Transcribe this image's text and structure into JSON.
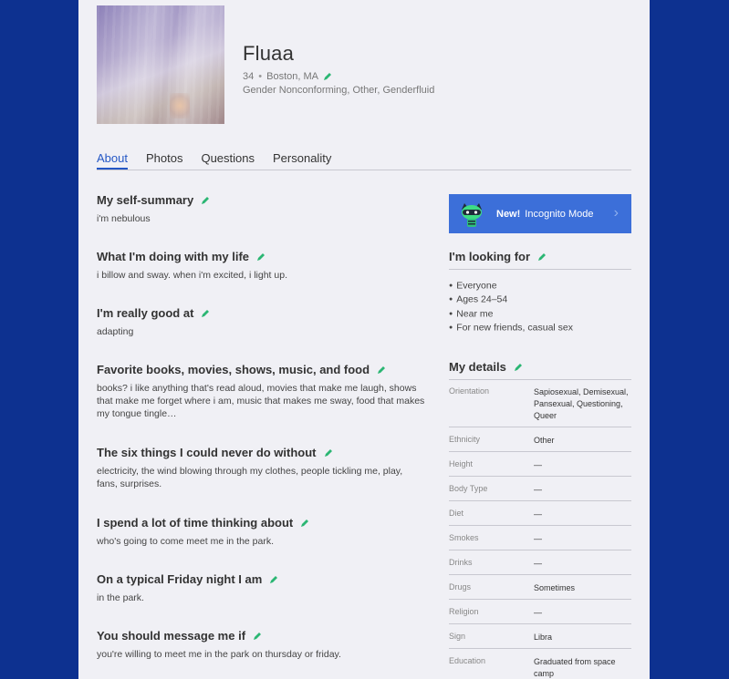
{
  "profile": {
    "name": "Fluaa",
    "age": "34",
    "location": "Boston, MA",
    "gender": "Gender Nonconforming, Other, Genderfluid"
  },
  "tabs": [
    "About",
    "Photos",
    "Questions",
    "Personality"
  ],
  "essays": [
    {
      "title": "My self-summary",
      "text": "i'm nebulous"
    },
    {
      "title": "What I'm doing with my life",
      "text": "i billow and sway. when i'm excited, i light up."
    },
    {
      "title": "I'm really good at",
      "text": "adapting"
    },
    {
      "title": "Favorite books, movies, shows, music, and food",
      "text": "books? i like anything that's read aloud, movies that make me laugh, shows that make me forget where i am, music that makes me sway, food that makes my tongue tingle…"
    },
    {
      "title": "The six things I could never do without",
      "text": "electricity, the wind blowing through my clothes, people tickling me, play, fans, surprises."
    },
    {
      "title": "I spend a lot of time thinking about",
      "text": "who's going to come meet me in the park."
    },
    {
      "title": "On a typical Friday night I am",
      "text": "in the park."
    },
    {
      "title": "You should message me if",
      "text": "you're willing to meet me in the park on thursday or friday."
    }
  ],
  "incognito": {
    "new": "New!",
    "label": "Incognito Mode"
  },
  "looking_for": {
    "title": "I'm looking for",
    "items": [
      "Everyone",
      "Ages 24–54",
      "Near me",
      "For new friends, casual sex"
    ]
  },
  "details": {
    "title": "My details",
    "rows": [
      {
        "key": "Orientation",
        "value": "Sapiosexual, Demisexual, Pansexual, Questioning, Queer"
      },
      {
        "key": "Ethnicity",
        "value": "Other"
      },
      {
        "key": "Height",
        "value": "—"
      },
      {
        "key": "Body Type",
        "value": "—"
      },
      {
        "key": "Diet",
        "value": "—"
      },
      {
        "key": "Smokes",
        "value": "—"
      },
      {
        "key": "Drinks",
        "value": "—"
      },
      {
        "key": "Drugs",
        "value": "Sometimes"
      },
      {
        "key": "Religion",
        "value": "—"
      },
      {
        "key": "Sign",
        "value": "Libra"
      },
      {
        "key": "Education",
        "value": "Graduated from space camp"
      }
    ]
  },
  "colors": {
    "accent": "#2457c5",
    "edit": "#2bb673",
    "background": "#0d3190",
    "incognito": "#3c6fd9"
  }
}
